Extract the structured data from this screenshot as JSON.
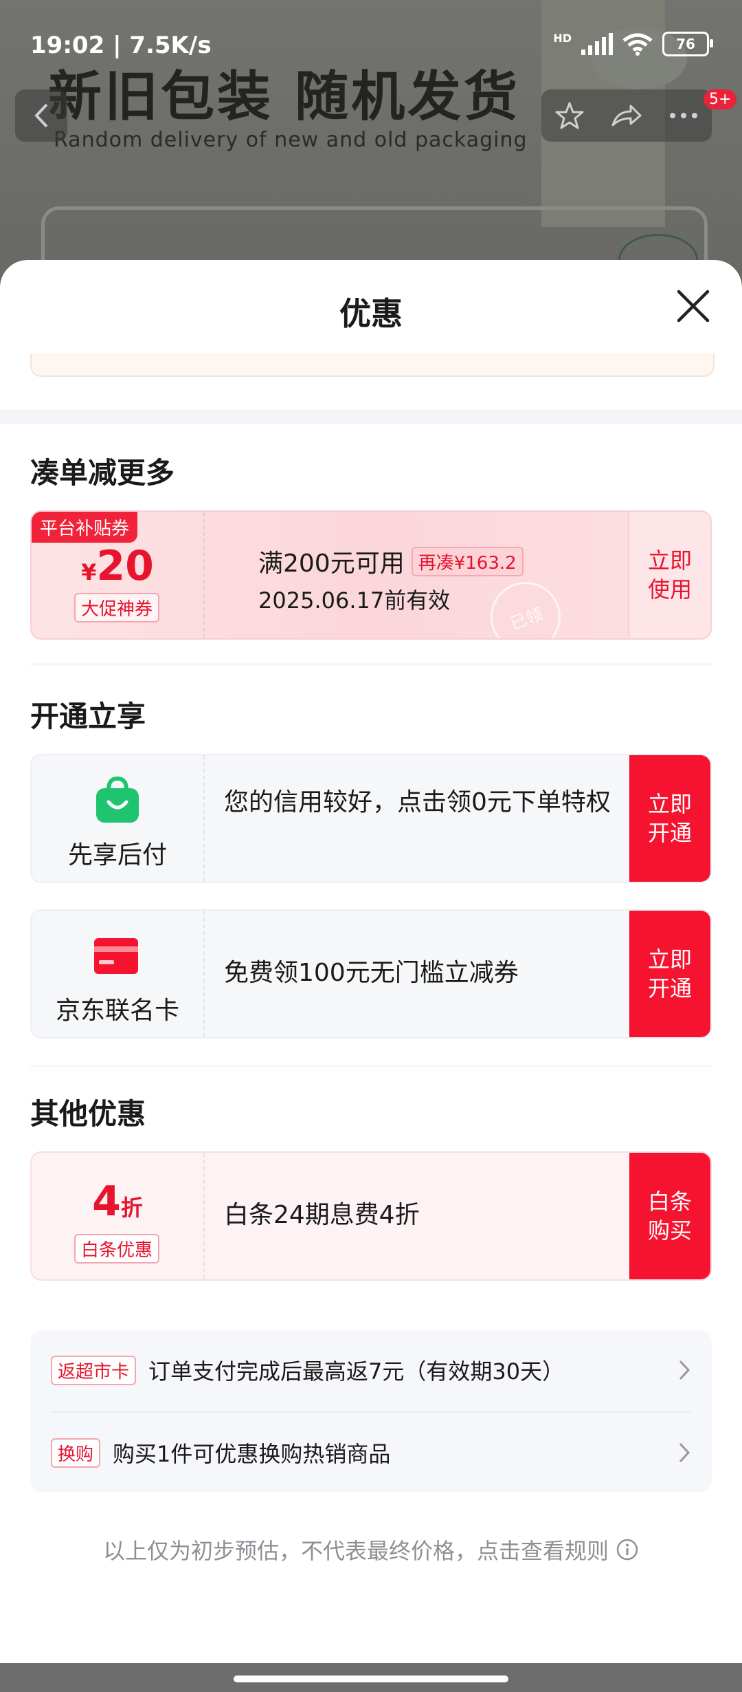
{
  "background": {
    "headline": "新旧包装 随机发货",
    "subline": "Random delivery of new and old packaging"
  },
  "status_bar": {
    "time": "19:02 | 7.5K/s",
    "network": "HD",
    "battery": "76"
  },
  "nav": {
    "badge": "5+"
  },
  "sheet": {
    "title": "优惠"
  },
  "sections": {
    "bundle": "凑单减更多",
    "activate": "开通立享",
    "other": "其他优惠"
  },
  "coupon_platform": {
    "tag": "平台补贴券",
    "currency": "¥",
    "amount": "20",
    "promo": "大促神券",
    "condition": "满200元可用",
    "chip": "再凑¥163.2",
    "validity": "2025.06.17前有效",
    "action": "立即使用",
    "stamp": "已领"
  },
  "coupon_paylater": {
    "label": "先享后付",
    "text": "您的信用较好，点击领0元下单特权",
    "action": "立即开通"
  },
  "coupon_card": {
    "label": "京东联名卡",
    "text": "免费领100元无门槛立减券",
    "action": "立即开通"
  },
  "coupon_baitiao": {
    "amount": "4",
    "unit": "折",
    "promo": "白条优惠",
    "text": "白条24期息费4折",
    "action": "白条购买"
  },
  "info": {
    "rows": [
      {
        "tag": "返超市卡",
        "text": "订单支付完成后最高返7元（有效期30天）"
      },
      {
        "tag": "换购",
        "text": "购买1件可优惠换购热销商品"
      }
    ]
  },
  "disclaimer": "以上仅为初步预估，不代表最终价格，点击查看规则",
  "colors": {
    "accent": "#f5132f",
    "coupon_pink": "#fde3e5",
    "muted_text": "#8d8f94"
  }
}
